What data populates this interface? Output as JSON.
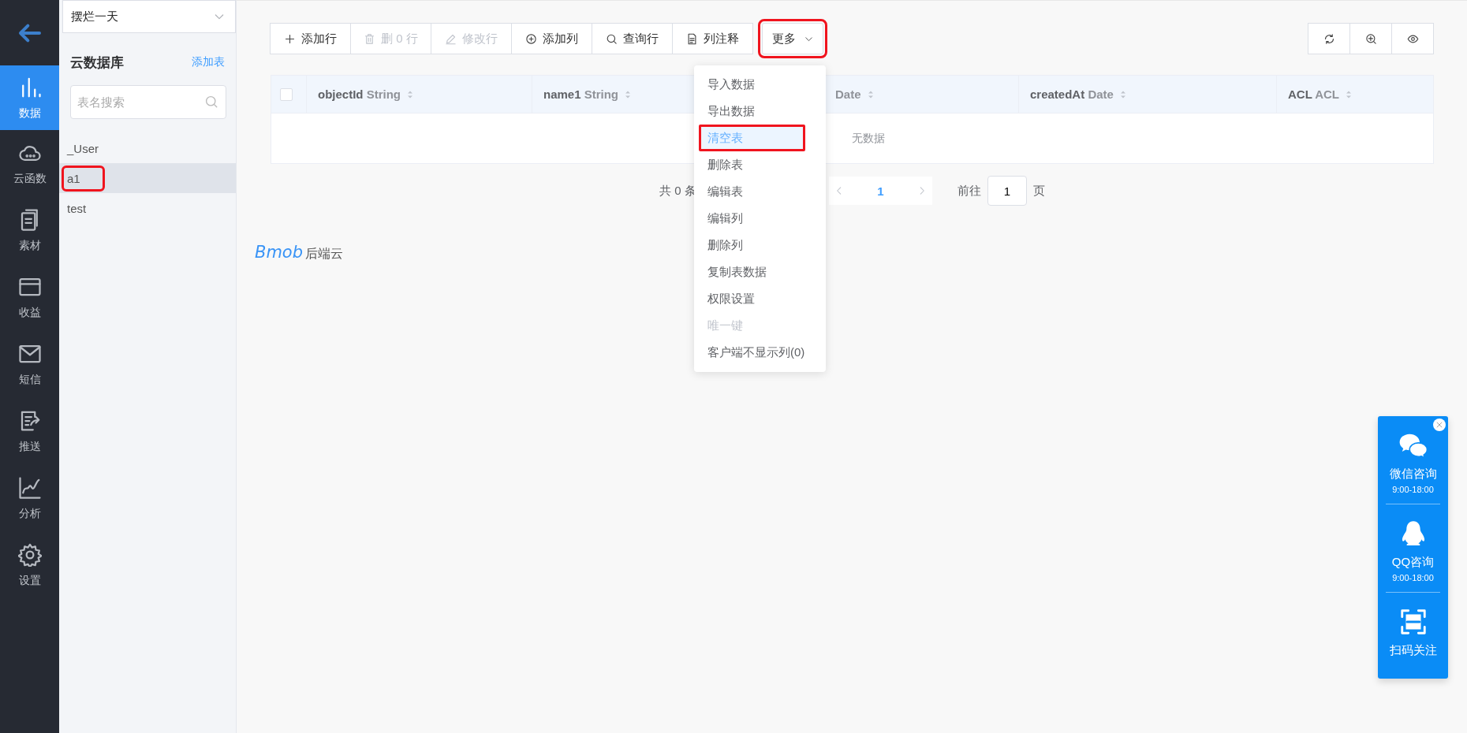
{
  "project_select": {
    "value": "摆烂一天"
  },
  "nav": {
    "items": [
      {
        "kind": "data",
        "label": "数据",
        "selected": true
      },
      {
        "kind": "cloud",
        "label": "云函数",
        "selected": false
      },
      {
        "kind": "docs",
        "label": "素材",
        "selected": false
      },
      {
        "kind": "card",
        "label": "收益",
        "selected": false
      },
      {
        "kind": "mail",
        "label": "短信",
        "selected": false
      },
      {
        "kind": "push",
        "label": "推送",
        "selected": false
      },
      {
        "kind": "chart",
        "label": "分析",
        "selected": false
      },
      {
        "kind": "gear",
        "label": "设置",
        "selected": false
      }
    ]
  },
  "table_list": {
    "title": "云数据库",
    "add_link": "添加表",
    "search": {
      "placeholder": "表名搜索"
    },
    "items": [
      {
        "label": "_User",
        "selected": false,
        "highlighted": false
      },
      {
        "label": "a1",
        "selected": true,
        "highlighted": true
      },
      {
        "label": "test",
        "selected": false,
        "highlighted": false
      }
    ]
  },
  "toolbar": {
    "buttons": [
      {
        "kind": "plus",
        "label": "添加行",
        "disabled": false
      },
      {
        "kind": "trash",
        "label": "删 0 行",
        "disabled": true
      },
      {
        "kind": "pen",
        "label": "修改行",
        "disabled": true
      },
      {
        "kind": "plus-circle",
        "label": "添加列",
        "disabled": false
      },
      {
        "kind": "search",
        "label": "查询行",
        "disabled": false
      },
      {
        "kind": "doc",
        "label": "列注释",
        "disabled": false
      }
    ],
    "more": {
      "label": "更多",
      "highlighted": true
    },
    "tools": [
      {
        "kind": "refresh"
      },
      {
        "kind": "zoom"
      },
      {
        "kind": "eye"
      }
    ]
  },
  "table": {
    "select_all": {
      "checked": false
    },
    "columns": [
      {
        "name": "objectId",
        "type": "String"
      },
      {
        "name": "name1",
        "type": "String"
      },
      {
        "type": "Date"
      },
      {
        "name": "createdAt",
        "type": "Date"
      },
      {
        "name": "ACL",
        "type": "ACL"
      }
    ],
    "empty_text": "无数据"
  },
  "pagination": {
    "total": "共 0 条",
    "pages": [
      {
        "label": "1",
        "selected": true
      }
    ],
    "goto_label": "前往",
    "goto_value": "1",
    "page_suffix": "页"
  },
  "logo": {
    "brand": "Bmob",
    "suffix": "后端云"
  },
  "more_menu": {
    "items": [
      {
        "label": "导入数据",
        "selected": false,
        "disabled": false,
        "highlighted": false
      },
      {
        "label": "导出数据",
        "selected": false,
        "disabled": false,
        "highlighted": false
      },
      {
        "label": "清空表",
        "selected": true,
        "disabled": false,
        "highlighted": true
      },
      {
        "label": "删除表",
        "selected": false,
        "disabled": false,
        "highlighted": false
      },
      {
        "label": "编辑表",
        "selected": false,
        "disabled": false,
        "highlighted": false
      },
      {
        "label": "编辑列",
        "selected": false,
        "disabled": false,
        "highlighted": false
      },
      {
        "label": "删除列",
        "selected": false,
        "disabled": false,
        "highlighted": false
      },
      {
        "label": "复制表数据",
        "selected": false,
        "disabled": false,
        "highlighted": false
      },
      {
        "label": "权限设置",
        "selected": false,
        "disabled": false,
        "highlighted": false
      },
      {
        "label": "唯一键",
        "selected": false,
        "disabled": true,
        "highlighted": false
      },
      {
        "label": "客户端不显示列(0)",
        "selected": false,
        "disabled": false,
        "highlighted": false
      }
    ]
  },
  "contact": {
    "items": [
      {
        "kind": "wechat",
        "label": "微信咨询",
        "hours": "9:00-18:00"
      },
      {
        "kind": "qq",
        "label": "QQ咨询",
        "hours": "9:00-18:00"
      },
      {
        "kind": "scan",
        "label": "扫码关注"
      }
    ]
  }
}
